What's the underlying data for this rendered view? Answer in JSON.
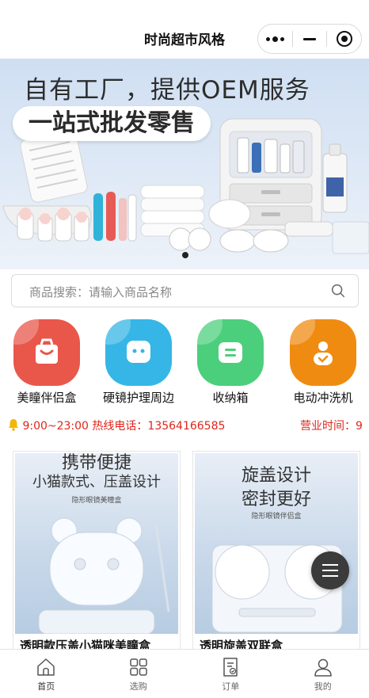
{
  "header": {
    "title": "时尚超市风格"
  },
  "banner": {
    "headline": "自有工厂，提供OEM服务",
    "subheadline": "一站式批发零售"
  },
  "search": {
    "placeholder": "商品搜索：请输入商品名称"
  },
  "categories": [
    {
      "label": "美瞳伴侣盒",
      "icon": "shopping-bag-icon",
      "color": "#e8574a"
    },
    {
      "label": "硬镜护理周边",
      "icon": "chat-face-icon",
      "color": "#35b6e6"
    },
    {
      "label": "收纳箱",
      "icon": "storage-box-icon",
      "color": "#4ccf7c"
    },
    {
      "label": "电动冲洗机",
      "icon": "person-icon",
      "color": "#f08b12"
    }
  ],
  "notice": {
    "text": "9:00~23:00 热线电话：13564166585",
    "hours_label": "营业时间：9"
  },
  "products": [
    {
      "image_line1": "携带便捷",
      "image_line2": "小猫款式、压盖设计",
      "image_caption": "隐形眼镜美瞳盒",
      "title": "透明款压盖小猫咪美瞳盒"
    },
    {
      "image_line1": "旋盖设计",
      "image_line2": "密封更好",
      "image_caption": "隐形眼镜伴侣盒",
      "title": "透明旋盖双联盒"
    }
  ],
  "tabs": [
    {
      "label": "首页",
      "icon": "home-icon",
      "active": true
    },
    {
      "label": "选购",
      "icon": "grid-icon",
      "active": false
    },
    {
      "label": "订单",
      "icon": "order-icon",
      "active": false
    },
    {
      "label": "我的",
      "icon": "user-icon",
      "active": false
    }
  ],
  "colors": {
    "accent": "#e1251b",
    "header_bg": "#ffffff"
  }
}
